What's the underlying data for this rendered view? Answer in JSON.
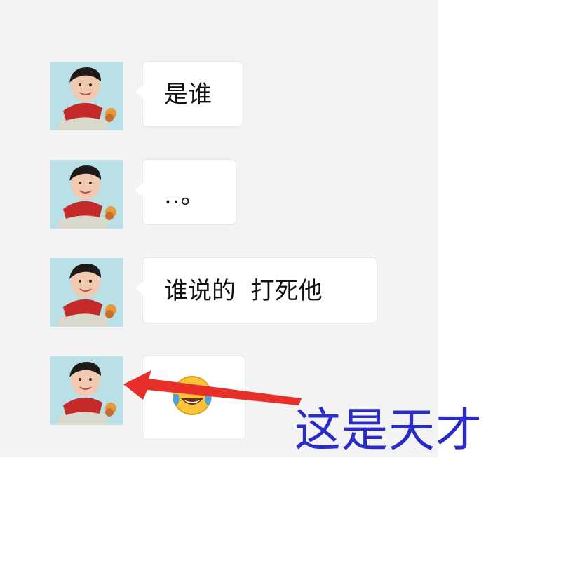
{
  "chat": {
    "messages": [
      {
        "text": "是谁",
        "avatar": "child-avatar"
      },
      {
        "text": "..。",
        "avatar": "child-avatar"
      },
      {
        "text": "谁说的  打死他",
        "avatar": "child-avatar"
      },
      {
        "emoji": "tears-of-joy-emoji",
        "avatar": "child-avatar"
      }
    ]
  },
  "annotation": {
    "text": "这是天才",
    "text_color": "#2b2bc8",
    "arrow_color": "#e8302a"
  },
  "colors": {
    "chat_background": "#f3f3f3",
    "bubble_background": "#ffffff"
  }
}
